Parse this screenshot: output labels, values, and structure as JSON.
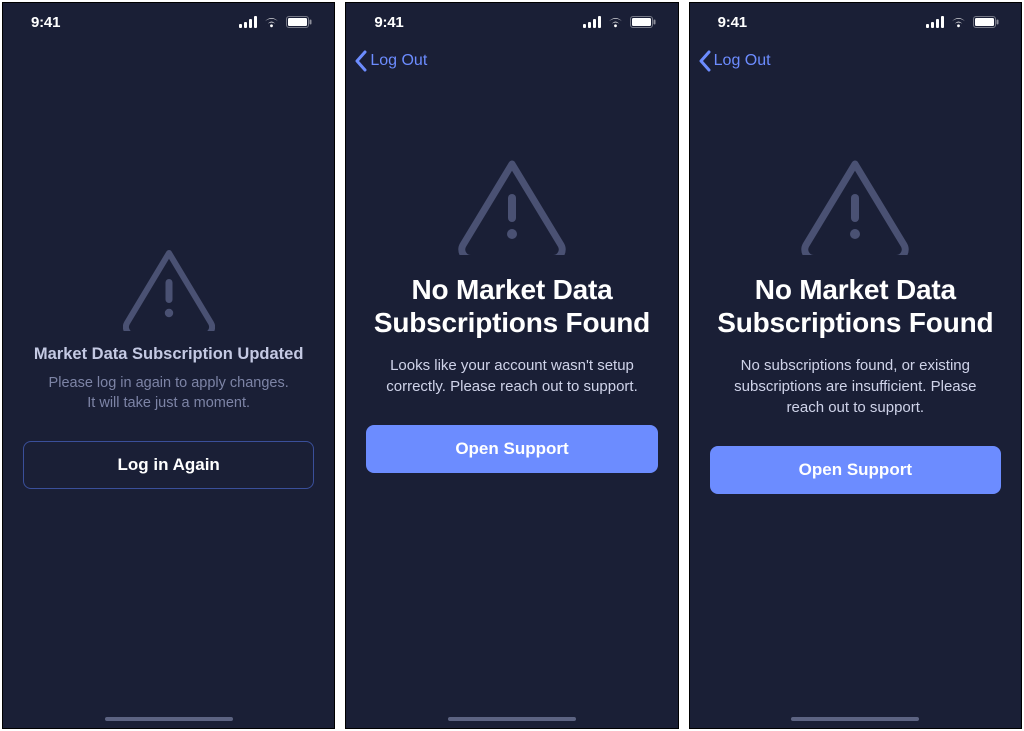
{
  "status": {
    "time": "9:41"
  },
  "nav": {
    "back_label": "Log Out"
  },
  "screens": [
    {
      "title": "Market Data Subscription Updated",
      "body": "Please log in again to apply changes.\nIt will take just a moment.",
      "cta": "Log in Again"
    },
    {
      "title": "No Market Data Subscriptions Found",
      "body": "Looks like your account wasn't setup correctly. Please reach out to support.",
      "cta": "Open Support"
    },
    {
      "title": "No Market Data Subscriptions Found",
      "body": "No subscriptions found, or existing subscriptions are insufficient. Please reach out to support.",
      "cta": "Open Support"
    }
  ]
}
